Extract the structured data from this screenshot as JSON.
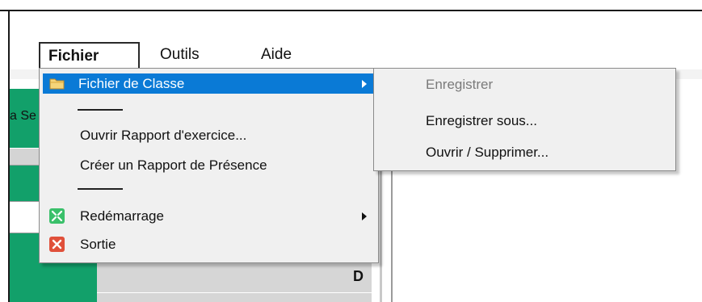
{
  "background": {
    "partial_text": "a Se",
    "grid_header_letter": "D"
  },
  "menubar": {
    "items": [
      {
        "label": "Fichier"
      },
      {
        "label": "Outils"
      },
      {
        "label": "Aide"
      }
    ]
  },
  "dropdown": {
    "items": {
      "class_file": "Fichier de Classe",
      "open_report": "Ouvrir Rapport d'exercice...",
      "create_report": "Créer un Rapport de Présence",
      "restart": "Redémarrage",
      "exit": "Sortie"
    }
  },
  "submenu": {
    "items": {
      "save": "Enregistrer",
      "save_as": "Enregistrer sous...",
      "open_delete": "Ouvrir / Supprimer..."
    }
  },
  "colors": {
    "highlight": "#0a7ad6",
    "green_panel": "#12a06a",
    "restart_icon": "#3ac06a",
    "exit_icon": "#e0503a",
    "folder_icon": "#e8b84a"
  },
  "icons": {
    "class_file": "folder-icon",
    "restart": "restart-icon",
    "exit": "close-icon"
  }
}
